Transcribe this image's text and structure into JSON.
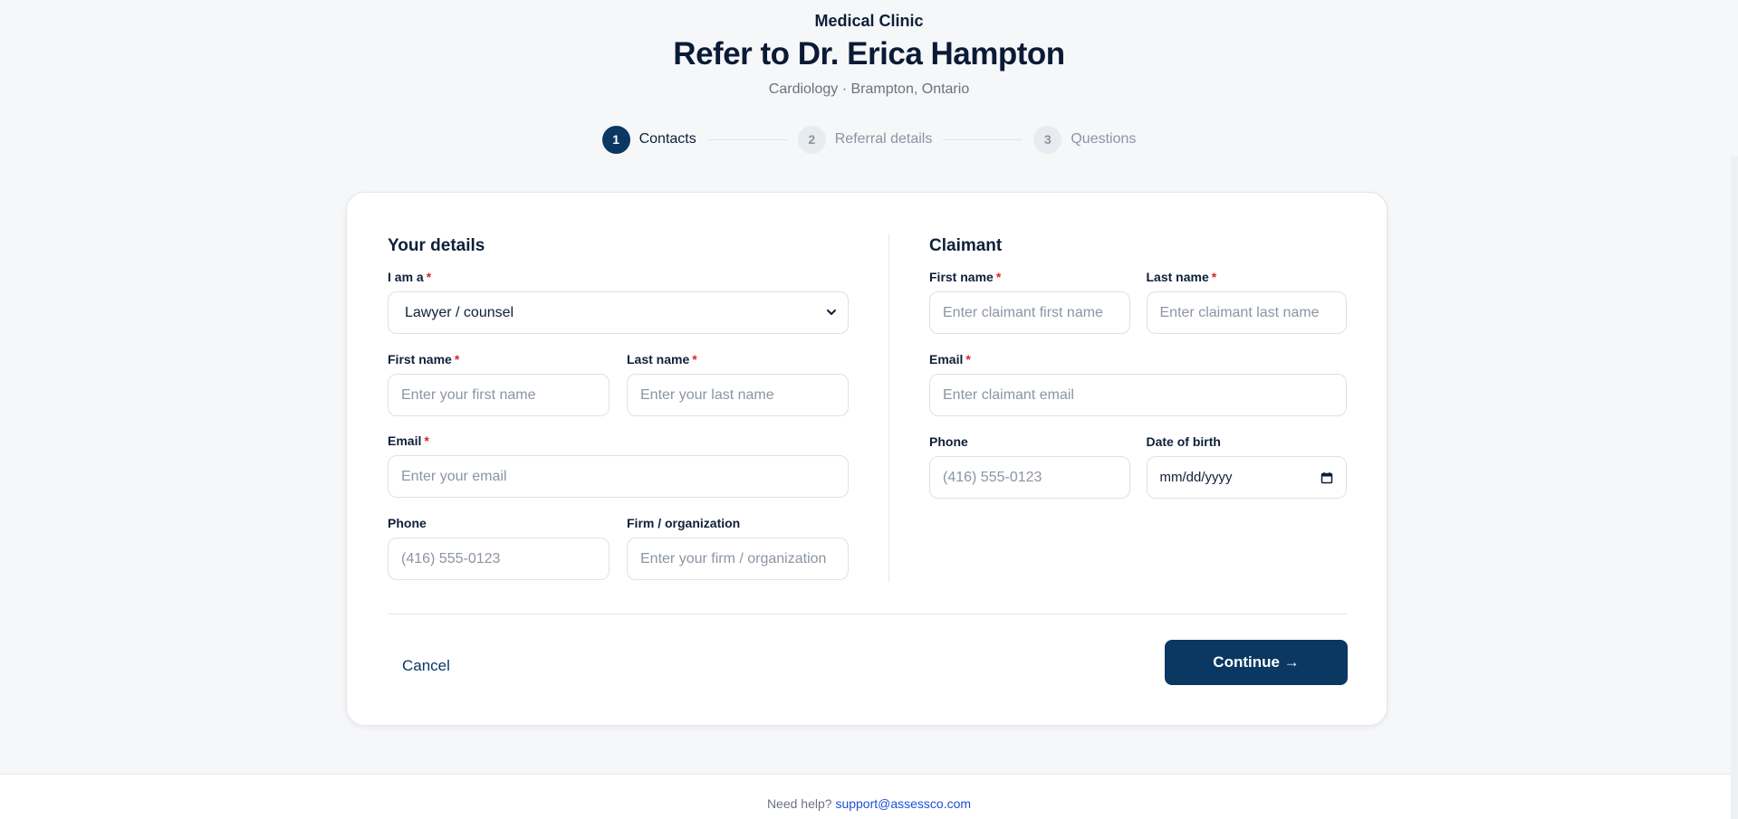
{
  "header": {
    "clinic": "Medical Clinic",
    "title": "Refer to Dr. Erica Hampton",
    "subtitle": "Cardiology · Brampton, Ontario"
  },
  "steps": [
    {
      "num": "1",
      "label": "Contacts",
      "active": true
    },
    {
      "num": "2",
      "label": "Referral details",
      "active": false
    },
    {
      "num": "3",
      "label": "Questions",
      "active": false
    }
  ],
  "your_details": {
    "title": "Your details",
    "role_label": "I am a",
    "role_value": "Lawyer / counsel",
    "first_name_label": "First name",
    "first_name_placeholder": "Enter your first name",
    "last_name_label": "Last name",
    "last_name_placeholder": "Enter your last name",
    "email_label": "Email",
    "email_placeholder": "Enter your email",
    "phone_label": "Phone",
    "phone_placeholder": "(416) 555-0123",
    "firm_label": "Firm / organization",
    "firm_placeholder": "Enter your firm / organization"
  },
  "claimant": {
    "title": "Claimant",
    "first_name_label": "First name",
    "first_name_placeholder": "Enter claimant first name",
    "last_name_label": "Last name",
    "last_name_placeholder": "Enter claimant last name",
    "email_label": "Email",
    "email_placeholder": "Enter claimant email",
    "phone_label": "Phone",
    "phone_placeholder": "(416) 555-0123",
    "dob_label": "Date of birth",
    "dob_placeholder": "mm/dd/yyyy"
  },
  "actions": {
    "cancel": "Cancel",
    "continue": "Continue →"
  },
  "footer": {
    "help_text": "Need help?",
    "email": "support@assessco.com"
  },
  "colors": {
    "primary": "#0b3763",
    "required": "#dc2626",
    "link": "#1d4ed8"
  }
}
